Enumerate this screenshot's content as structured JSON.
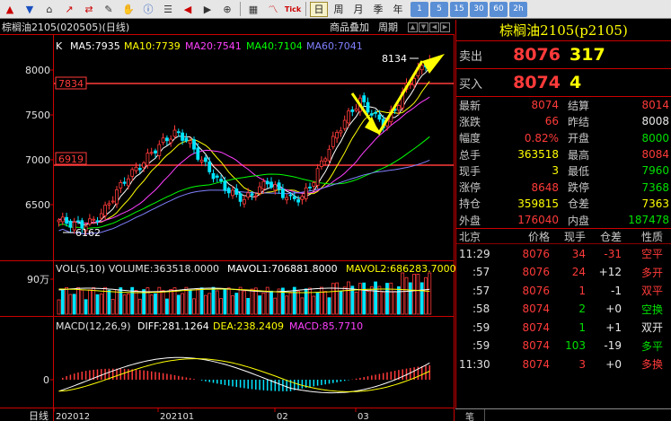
{
  "toolbar": {
    "icons": [
      "up-icon",
      "down-icon",
      "home-icon",
      "trend-icon",
      "compare-icon",
      "draw-icon",
      "hand-icon",
      "info-icon",
      "list-icon",
      "back-icon",
      "forward-icon",
      "zoom-icon",
      "table-icon",
      "line-icon",
      "tick-icon"
    ],
    "tick_label": "Tick",
    "periods": [
      {
        "label": "日",
        "active": true
      },
      {
        "label": "周",
        "active": false
      },
      {
        "label": "月",
        "active": false
      },
      {
        "label": "季",
        "active": false
      },
      {
        "label": "年",
        "active": false
      }
    ],
    "minutes": [
      "1",
      "5",
      "15",
      "30",
      "60",
      "2h"
    ]
  },
  "chart": {
    "symbol_line": "棕榈油2105(020505)(日线)",
    "overlay_label": "商品叠加",
    "period_label": "周期",
    "k_label": "K",
    "ma5": "MA5:7935",
    "ma10": "MA10:7739",
    "ma20": "MA20:7541",
    "ma40": "MA40:7104",
    "ma60": "MA60:7041",
    "price_ticks": [
      "8000",
      "7500",
      "7000",
      "6500"
    ],
    "marker_hi": "7834",
    "marker_lo": "6919",
    "ann_high": "8134",
    "ann_low": "6162",
    "vol_title": "VOL(5,10) VOLUME:363518.0000",
    "vol_mavol1": "MAVOL1:706881.8000",
    "vol_mavol2": "MAVOL2:686283.7000",
    "vol_axis": "90万",
    "macd_title": "MACD(12,26,9)",
    "macd_diff": "DIFF:281.1264",
    "macd_dea": "DEA:238.2409",
    "macd_val": "MACD:85.7710",
    "macd_zero": "0",
    "x_label": "日线",
    "x_ticks": [
      "202012",
      "202101",
      "02",
      "03"
    ]
  },
  "colors": {
    "up": "#ff3a3a",
    "down": "#00e5ff",
    "ma5": "#ffffff",
    "ma10": "#ffff00",
    "ma20": "#ff40ff",
    "ma40": "#00ff00",
    "ma60": "#8080ff"
  },
  "quote": {
    "title": "棕榈油2105(p2105)",
    "ask_label": "卖出",
    "ask_price": "8076",
    "ask_vol": "317",
    "bid_label": "买入",
    "bid_price": "8074",
    "bid_vol": "4",
    "stats": [
      {
        "l1": "最新",
        "v1": "8074",
        "c1": "red",
        "l2": "结算",
        "v2": "8014",
        "c2": "red"
      },
      {
        "l1": "涨跌",
        "v1": "66",
        "c1": "red",
        "l2": "昨结",
        "v2": "8008",
        "c2": "wht"
      },
      {
        "l1": "幅度",
        "v1": "0.82%",
        "c1": "red",
        "l2": "开盘",
        "v2": "8000",
        "c2": "grn"
      },
      {
        "l1": "总手",
        "v1": "363518",
        "c1": "yel",
        "l2": "最高",
        "v2": "8084",
        "c2": "red"
      },
      {
        "l1": "现手",
        "v1": "3",
        "c1": "yel",
        "l2": "最低",
        "v2": "7960",
        "c2": "grn"
      },
      {
        "l1": "涨停",
        "v1": "8648",
        "c1": "red",
        "l2": "跌停",
        "v2": "7368",
        "c2": "grn"
      },
      {
        "l1": "持仓",
        "v1": "359815",
        "c1": "yel",
        "l2": "仓差",
        "v2": "7363",
        "c2": "yel"
      },
      {
        "l1": "外盘",
        "v1": "176040",
        "c1": "red",
        "l2": "内盘",
        "v2": "187478",
        "c2": "grn"
      }
    ],
    "tick_head": [
      "北京",
      "价格",
      "现手",
      "仓差",
      "性质"
    ],
    "ticks": [
      {
        "t": "11:29",
        "p": "8076",
        "v": "34",
        "d": "-31",
        "n": "空平",
        "pc": "red",
        "vc": "red",
        "dc": "red",
        "nc": "red"
      },
      {
        "t": ":57",
        "p": "8076",
        "v": "24",
        "d": "+12",
        "pc": "red",
        "vc": "red",
        "dc": "wht",
        "n": "多开",
        "nc": "red"
      },
      {
        "t": ":57",
        "p": "8076",
        "v": "1",
        "d": "-1",
        "pc": "red",
        "vc": "red",
        "dc": "wht",
        "n": "双平",
        "nc": "red"
      },
      {
        "t": ":58",
        "p": "8074",
        "v": "2",
        "d": "+0",
        "pc": "red",
        "vc": "grn",
        "dc": "wht",
        "n": "空换",
        "nc": "grn"
      },
      {
        "t": ":59",
        "p": "8074",
        "v": "1",
        "d": "+1",
        "pc": "red",
        "vc": "grn",
        "dc": "wht",
        "n": "双开",
        "nc": "wht"
      },
      {
        "t": ":59",
        "p": "8074",
        "v": "103",
        "d": "-19",
        "pc": "red",
        "vc": "grn",
        "dc": "wht",
        "n": "多平",
        "nc": "grn"
      },
      {
        "t": "11:30",
        "p": "8074",
        "v": "3",
        "d": "+0",
        "pc": "red",
        "vc": "red",
        "dc": "wht",
        "n": "多换",
        "nc": "red"
      }
    ],
    "bottom_tab": "笔"
  }
}
